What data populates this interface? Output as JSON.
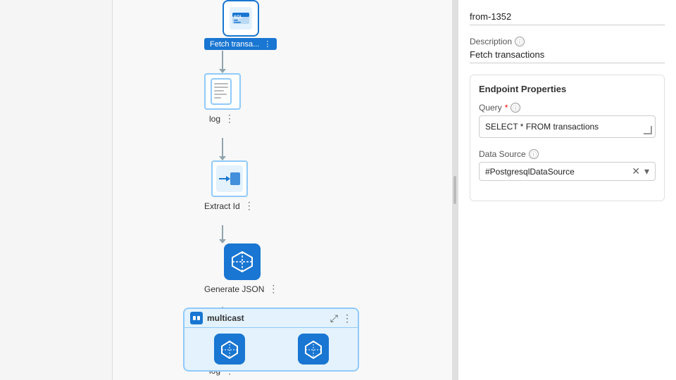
{
  "leftSidebar": {},
  "canvas": {
    "nodes": [
      {
        "id": "fetch",
        "label": "Fetch transa...",
        "type": "sql"
      },
      {
        "id": "log1",
        "label": "log",
        "type": "log"
      },
      {
        "id": "extractId",
        "label": "Extract Id",
        "type": "extract"
      },
      {
        "id": "generateJson",
        "label": "Generate JSON",
        "type": "generate-json"
      },
      {
        "id": "log2",
        "label": "log",
        "type": "log2"
      },
      {
        "id": "multicast",
        "label": "multicast",
        "type": "multicast"
      }
    ]
  },
  "rightPanel": {
    "description_label": "Description",
    "description_value": "Fetch transactions",
    "name_value": "from-1352",
    "section_title": "Endpoint Properties",
    "query_label": "Query",
    "query_required": "*",
    "query_value": "SELECT * FROM transactions",
    "datasource_label": "Data Source",
    "datasource_value": "#PostgresqlDataSource",
    "info_icon_label": "ⓘ",
    "dots_icon": "⋮",
    "expand_icon": "⤢",
    "clear_icon": "✕",
    "dropdown_icon": "▾",
    "multicast_expand": "⤢",
    "multicast_dots": "⋮"
  }
}
